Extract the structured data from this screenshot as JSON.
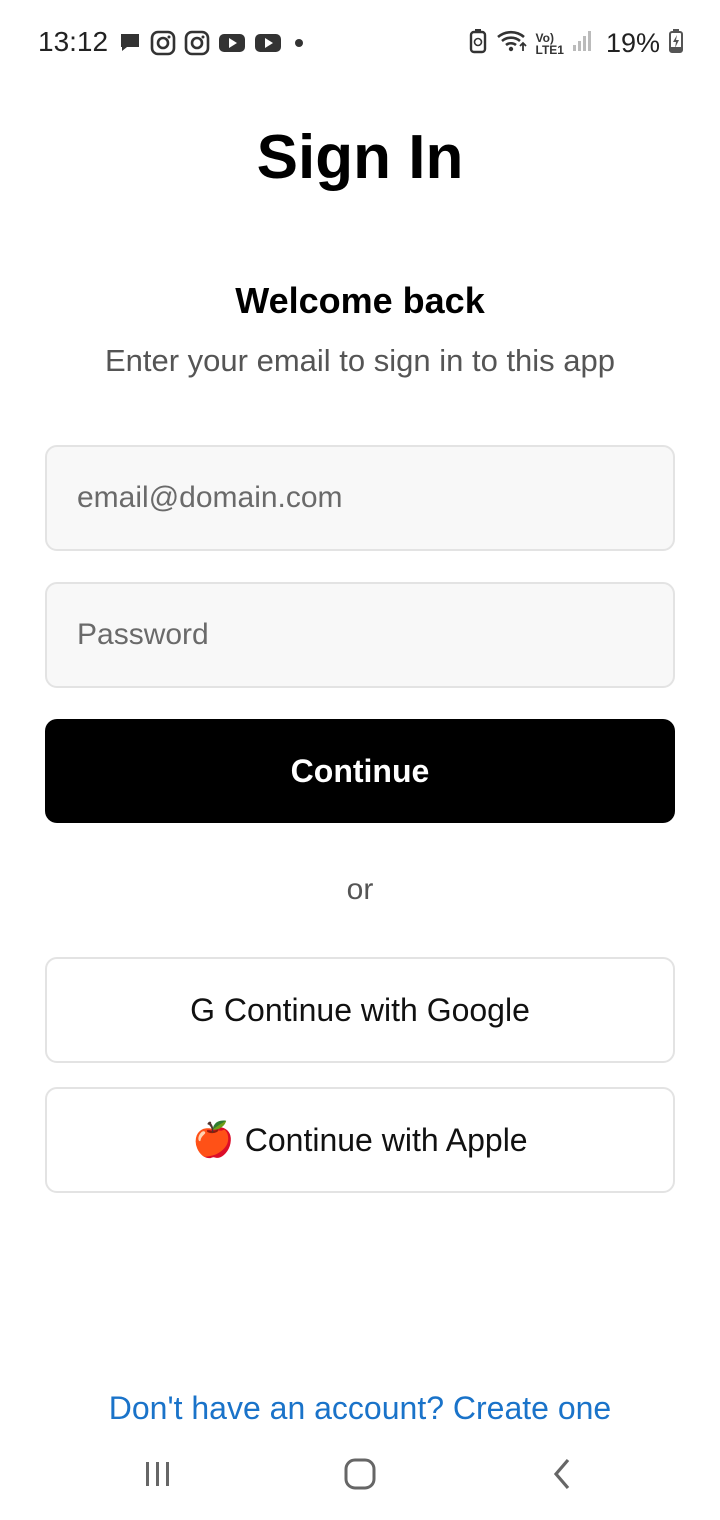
{
  "status_bar": {
    "time": "13:12",
    "notification_icons": [
      "message-icon",
      "instagram-icon",
      "instagram-icon",
      "youtube-icon",
      "youtube-icon",
      "dot-icon"
    ],
    "system_icons": [
      "battery-saver-icon",
      "wifi-icon",
      "volte-lte-icon",
      "signal-icon"
    ],
    "volte_label": "Vo)",
    "lte_label": "LTE1",
    "battery_percent": "19%"
  },
  "page": {
    "title": "Sign In",
    "welcome": "Welcome back",
    "subtitle": "Enter your email to sign in to this app"
  },
  "form": {
    "email_placeholder": "email@domain.com",
    "email_value": "",
    "password_placeholder": "Password",
    "password_value": "",
    "continue_label": "Continue",
    "or_label": "or"
  },
  "social": {
    "google_label": "G Continue with Google",
    "apple_emoji": "🍎",
    "apple_label": "Continue with Apple"
  },
  "footer": {
    "signup_link": "Don't have an account? Create one"
  },
  "nav_bar": {
    "icons": [
      "recents-icon",
      "home-icon",
      "back-icon"
    ]
  },
  "colors": {
    "primary_button": "#000000",
    "link": "#1a73c9",
    "field_background": "#f8f8f8",
    "border": "#e3e3e3"
  }
}
